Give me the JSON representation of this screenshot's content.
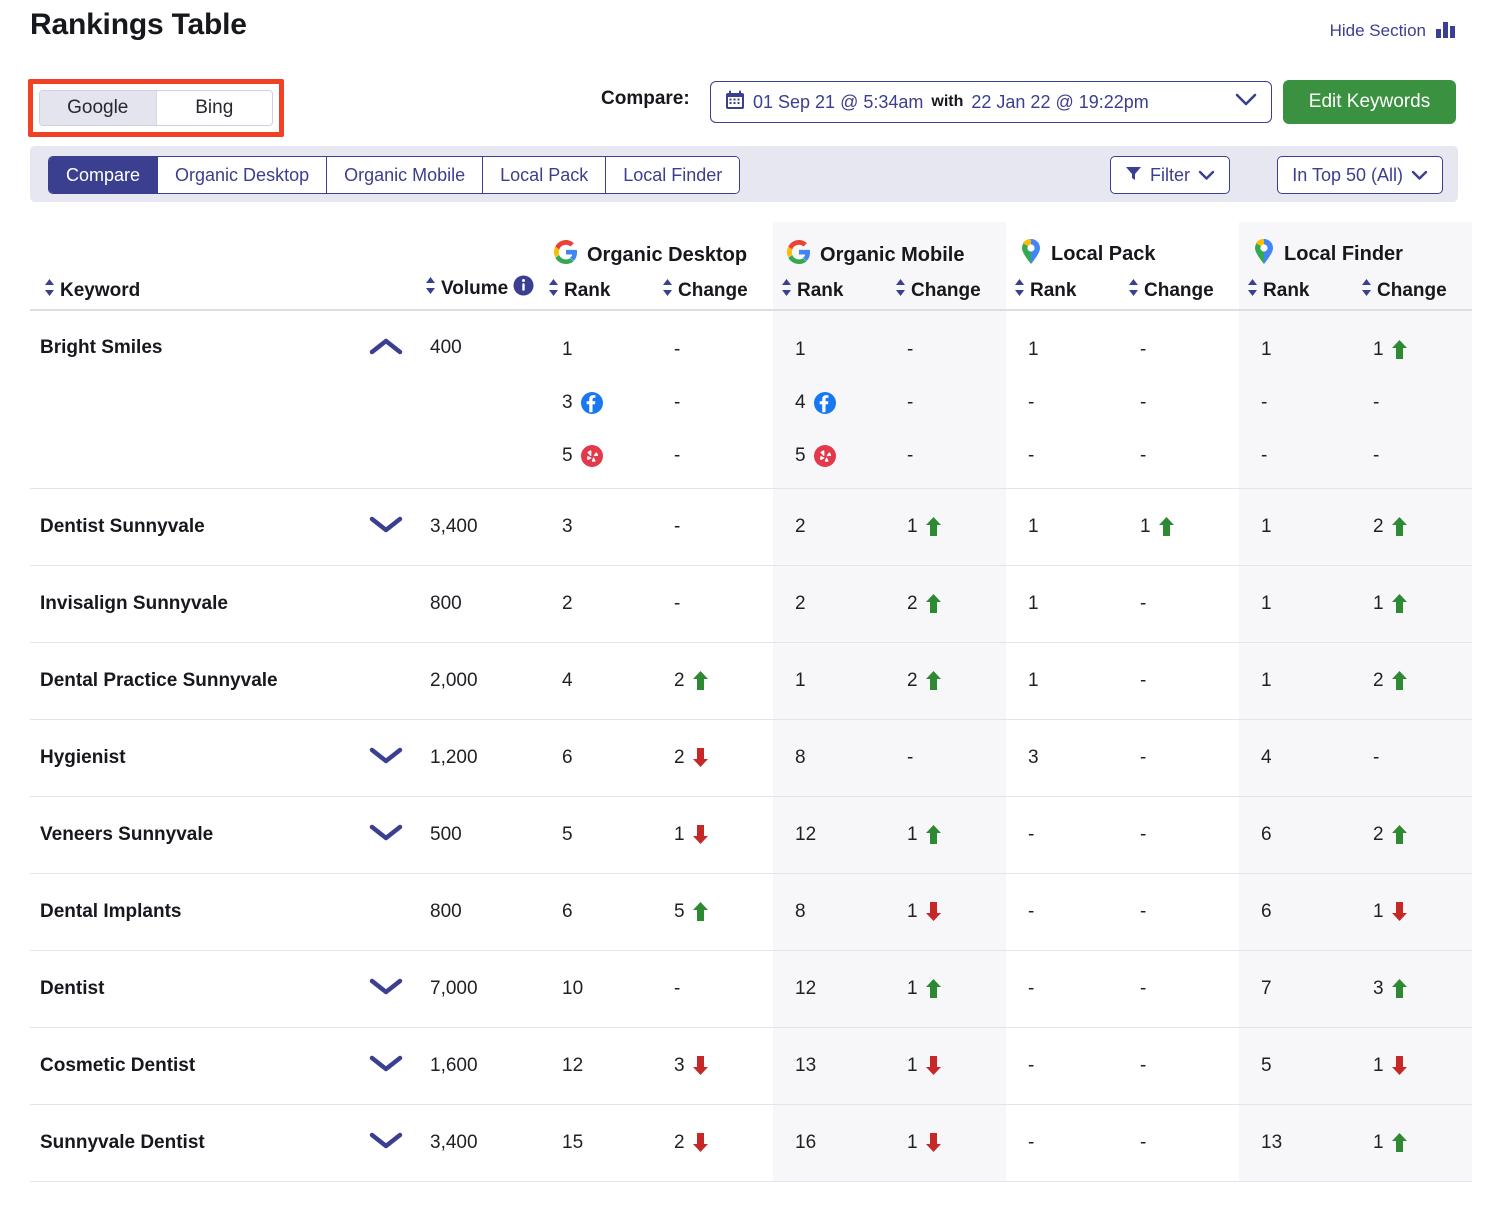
{
  "header": {
    "title": "Rankings Table",
    "hide_section_label": "Hide Section",
    "hide_section_icon": "bar-chart-icon"
  },
  "engine_toggle": {
    "options": [
      "Google",
      "Bing"
    ],
    "selected": "Google",
    "highlight_color": "#f04124"
  },
  "compare": {
    "label": "Compare:",
    "calendar_icon": "calendar-icon",
    "date_from": "01 Sep 21 @ 5:34am",
    "joiner": "with",
    "date_to": "22 Jan 22 @ 19:22pm",
    "chevron_icon": "chevron-down-icon",
    "edit_keywords_label": "Edit Keywords",
    "edit_keywords_color": "#3a913f"
  },
  "tabs": {
    "items": [
      "Compare",
      "Organic Desktop",
      "Organic Mobile",
      "Local Pack",
      "Local Finder"
    ],
    "active": "Compare",
    "accent_color": "#3b3f8f"
  },
  "controls": {
    "filter_label": "Filter",
    "filter_icon": "funnel-icon",
    "top_filter_label": "In Top 50 (All)",
    "chevron_icon": "chevron-down-icon"
  },
  "table": {
    "groups": [
      {
        "label": "Organic Desktop",
        "icon": "google-g-icon",
        "shaded": false
      },
      {
        "label": "Organic Mobile",
        "icon": "google-g-icon",
        "shaded": true
      },
      {
        "label": "Local Pack",
        "icon": "google-maps-pin-icon",
        "shaded": false
      },
      {
        "label": "Local Finder",
        "icon": "google-maps-pin-icon",
        "shaded": true
      }
    ],
    "columns": {
      "keyword": "Keyword",
      "volume": "Volume",
      "volume_info_icon": "info-icon",
      "rank": "Rank",
      "change": "Change",
      "sort_icon": "sort-updown-icon"
    },
    "rows": [
      {
        "keyword": "Bright Smiles",
        "trend": "up",
        "volume": "400",
        "organic_desktop": {
          "entries": [
            {
              "rank": "1",
              "badge": null,
              "change": "-",
              "dir": null
            },
            {
              "rank": "3",
              "badge": "facebook-icon",
              "change": "-",
              "dir": null
            },
            {
              "rank": "5",
              "badge": "yelp-icon",
              "change": "-",
              "dir": null
            }
          ]
        },
        "organic_mobile": {
          "entries": [
            {
              "rank": "1",
              "badge": null,
              "change": "-",
              "dir": null
            },
            {
              "rank": "4",
              "badge": "facebook-icon",
              "change": "-",
              "dir": null
            },
            {
              "rank": "5",
              "badge": "yelp-icon",
              "change": "-",
              "dir": null
            }
          ]
        },
        "local_pack": {
          "entries": [
            {
              "rank": "1",
              "badge": null,
              "change": "-",
              "dir": null
            },
            {
              "rank": "-",
              "badge": null,
              "change": "-",
              "dir": null
            },
            {
              "rank": "-",
              "badge": null,
              "change": "-",
              "dir": null
            }
          ]
        },
        "local_finder": {
          "entries": [
            {
              "rank": "1",
              "badge": null,
              "change": "1",
              "dir": "up"
            },
            {
              "rank": "-",
              "badge": null,
              "change": "-",
              "dir": null
            },
            {
              "rank": "-",
              "badge": null,
              "change": "-",
              "dir": null
            }
          ]
        }
      },
      {
        "keyword": "Dentist Sunnyvale",
        "trend": "down",
        "volume": "3,400",
        "organic_desktop": {
          "entries": [
            {
              "rank": "3",
              "badge": null,
              "change": "-",
              "dir": null
            }
          ]
        },
        "organic_mobile": {
          "entries": [
            {
              "rank": "2",
              "badge": null,
              "change": "1",
              "dir": "up"
            }
          ]
        },
        "local_pack": {
          "entries": [
            {
              "rank": "1",
              "badge": null,
              "change": "1",
              "dir": "up"
            }
          ]
        },
        "local_finder": {
          "entries": [
            {
              "rank": "1",
              "badge": null,
              "change": "2",
              "dir": "up"
            }
          ]
        }
      },
      {
        "keyword": "Invisalign Sunnyvale",
        "trend": null,
        "volume": "800",
        "organic_desktop": {
          "entries": [
            {
              "rank": "2",
              "badge": null,
              "change": "-",
              "dir": null
            }
          ]
        },
        "organic_mobile": {
          "entries": [
            {
              "rank": "2",
              "badge": null,
              "change": "2",
              "dir": "up"
            }
          ]
        },
        "local_pack": {
          "entries": [
            {
              "rank": "1",
              "badge": null,
              "change": "-",
              "dir": null
            }
          ]
        },
        "local_finder": {
          "entries": [
            {
              "rank": "1",
              "badge": null,
              "change": "1",
              "dir": "up"
            }
          ]
        }
      },
      {
        "keyword": "Dental Practice Sunnyvale",
        "trend": null,
        "volume": "2,000",
        "organic_desktop": {
          "entries": [
            {
              "rank": "4",
              "badge": null,
              "change": "2",
              "dir": "up"
            }
          ]
        },
        "organic_mobile": {
          "entries": [
            {
              "rank": "1",
              "badge": null,
              "change": "2",
              "dir": "up"
            }
          ]
        },
        "local_pack": {
          "entries": [
            {
              "rank": "1",
              "badge": null,
              "change": "-",
              "dir": null
            }
          ]
        },
        "local_finder": {
          "entries": [
            {
              "rank": "1",
              "badge": null,
              "change": "2",
              "dir": "up"
            }
          ]
        }
      },
      {
        "keyword": "Hygienist",
        "trend": "down",
        "volume": "1,200",
        "organic_desktop": {
          "entries": [
            {
              "rank": "6",
              "badge": null,
              "change": "2",
              "dir": "down"
            }
          ]
        },
        "organic_mobile": {
          "entries": [
            {
              "rank": "8",
              "badge": null,
              "change": "-",
              "dir": null
            }
          ]
        },
        "local_pack": {
          "entries": [
            {
              "rank": "3",
              "badge": null,
              "change": "-",
              "dir": null
            }
          ]
        },
        "local_finder": {
          "entries": [
            {
              "rank": "4",
              "badge": null,
              "change": "-",
              "dir": null
            }
          ]
        }
      },
      {
        "keyword": "Veneers Sunnyvale",
        "trend": "down",
        "volume": "500",
        "organic_desktop": {
          "entries": [
            {
              "rank": "5",
              "badge": null,
              "change": "1",
              "dir": "down"
            }
          ]
        },
        "organic_mobile": {
          "entries": [
            {
              "rank": "12",
              "badge": null,
              "change": "1",
              "dir": "up"
            }
          ]
        },
        "local_pack": {
          "entries": [
            {
              "rank": "-",
              "badge": null,
              "change": "-",
              "dir": null
            }
          ]
        },
        "local_finder": {
          "entries": [
            {
              "rank": "6",
              "badge": null,
              "change": "2",
              "dir": "up"
            }
          ]
        }
      },
      {
        "keyword": "Dental Implants",
        "trend": null,
        "volume": "800",
        "organic_desktop": {
          "entries": [
            {
              "rank": "6",
              "badge": null,
              "change": "5",
              "dir": "up"
            }
          ]
        },
        "organic_mobile": {
          "entries": [
            {
              "rank": "8",
              "badge": null,
              "change": "1",
              "dir": "down"
            }
          ]
        },
        "local_pack": {
          "entries": [
            {
              "rank": "-",
              "badge": null,
              "change": "-",
              "dir": null
            }
          ]
        },
        "local_finder": {
          "entries": [
            {
              "rank": "6",
              "badge": null,
              "change": "1",
              "dir": "down"
            }
          ]
        }
      },
      {
        "keyword": "Dentist",
        "trend": "down",
        "volume": "7,000",
        "organic_desktop": {
          "entries": [
            {
              "rank": "10",
              "badge": null,
              "change": "-",
              "dir": null
            }
          ]
        },
        "organic_mobile": {
          "entries": [
            {
              "rank": "12",
              "badge": null,
              "change": "1",
              "dir": "up"
            }
          ]
        },
        "local_pack": {
          "entries": [
            {
              "rank": "-",
              "badge": null,
              "change": "-",
              "dir": null
            }
          ]
        },
        "local_finder": {
          "entries": [
            {
              "rank": "7",
              "badge": null,
              "change": "3",
              "dir": "up"
            }
          ]
        }
      },
      {
        "keyword": "Cosmetic Dentist",
        "trend": "down",
        "volume": "1,600",
        "organic_desktop": {
          "entries": [
            {
              "rank": "12",
              "badge": null,
              "change": "3",
              "dir": "down"
            }
          ]
        },
        "organic_mobile": {
          "entries": [
            {
              "rank": "13",
              "badge": null,
              "change": "1",
              "dir": "down"
            }
          ]
        },
        "local_pack": {
          "entries": [
            {
              "rank": "-",
              "badge": null,
              "change": "-",
              "dir": null
            }
          ]
        },
        "local_finder": {
          "entries": [
            {
              "rank": "5",
              "badge": null,
              "change": "1",
              "dir": "down"
            }
          ]
        }
      },
      {
        "keyword": "Sunnyvale Dentist",
        "trend": "down",
        "volume": "3,400",
        "organic_desktop": {
          "entries": [
            {
              "rank": "15",
              "badge": null,
              "change": "2",
              "dir": "down"
            }
          ]
        },
        "organic_mobile": {
          "entries": [
            {
              "rank": "16",
              "badge": null,
              "change": "1",
              "dir": "down"
            }
          ]
        },
        "local_pack": {
          "entries": [
            {
              "rank": "-",
              "badge": null,
              "change": "-",
              "dir": null
            }
          ]
        },
        "local_finder": {
          "entries": [
            {
              "rank": "13",
              "badge": null,
              "change": "1",
              "dir": "up"
            }
          ]
        }
      }
    ]
  },
  "colors": {
    "accent": "#3b3f8f",
    "up": "#2d8a32",
    "down": "#c62828",
    "green_button": "#3a913f",
    "highlight": "#f04124"
  }
}
